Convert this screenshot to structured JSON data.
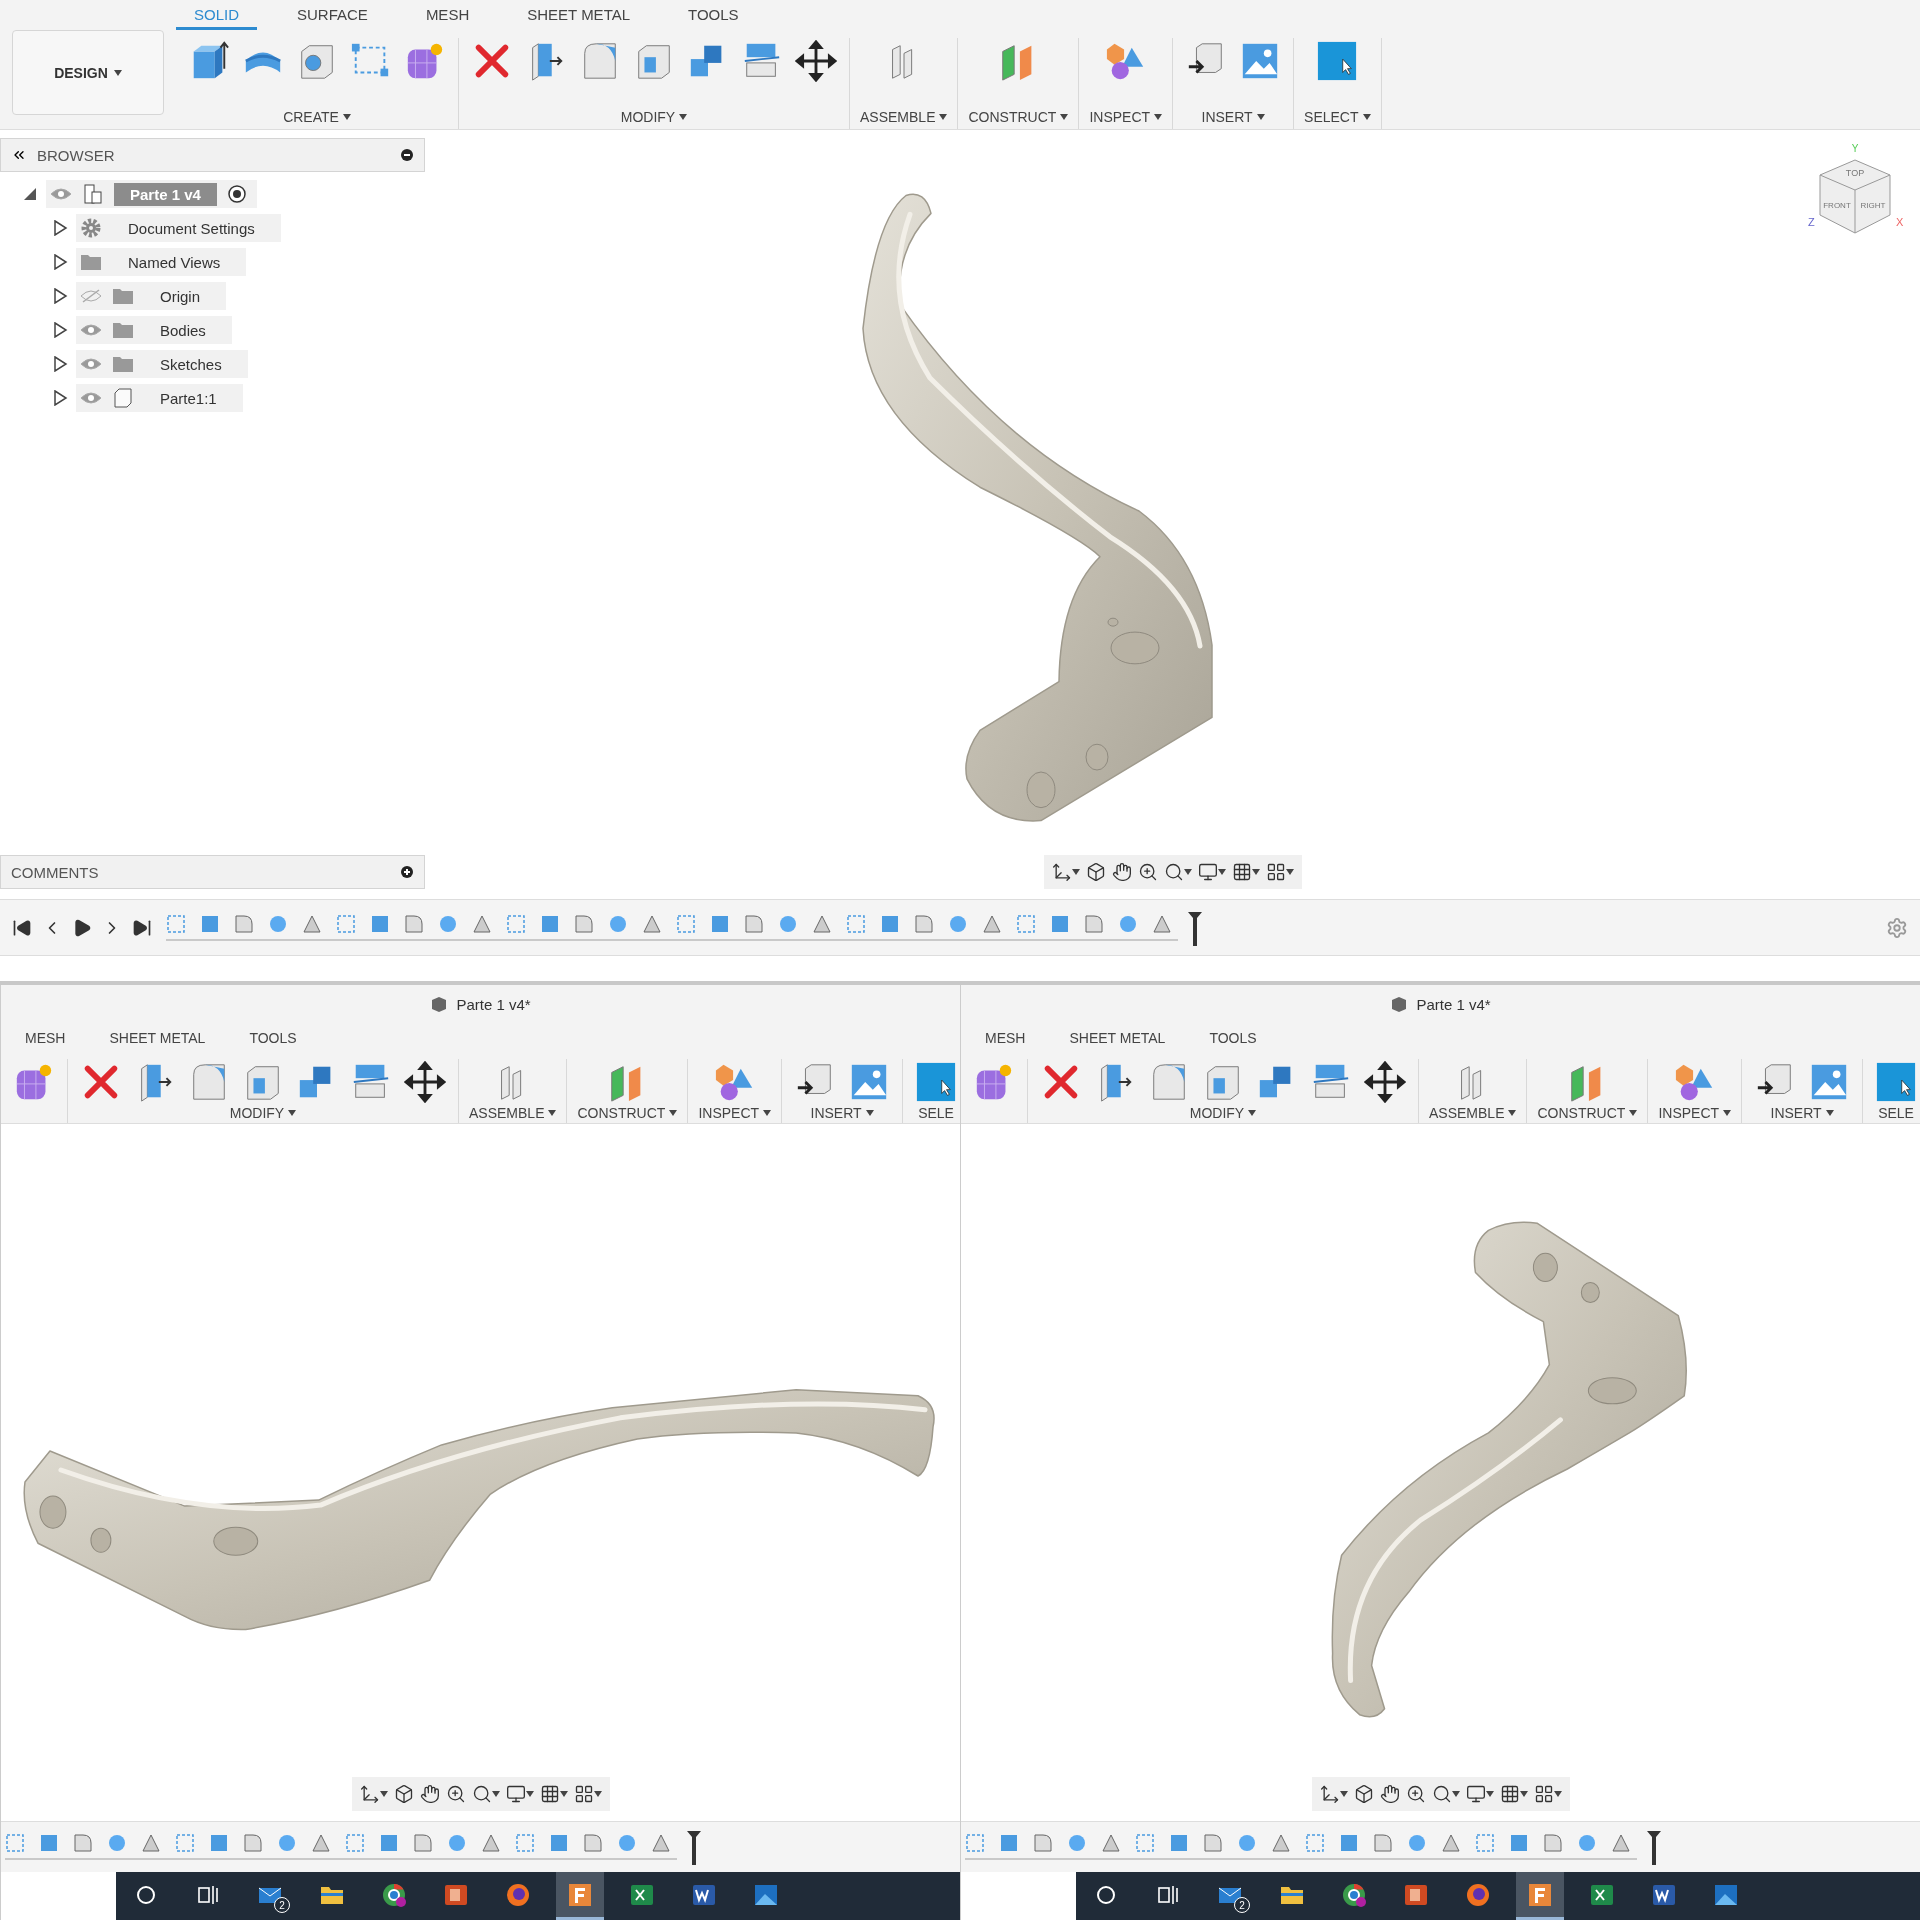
{
  "main": {
    "design_menu": "DESIGN",
    "tabs": [
      {
        "label": "SOLID",
        "selected": true
      },
      {
        "label": "SURFACE",
        "selected": false
      },
      {
        "label": "MESH",
        "selected": false
      },
      {
        "label": "SHEET METAL",
        "selected": false
      },
      {
        "label": "TOOLS",
        "selected": false
      }
    ],
    "groups": [
      "CREATE",
      "MODIFY",
      "ASSEMBLE",
      "CONSTRUCT",
      "INSPECT",
      "INSERT",
      "SELECT"
    ],
    "browser": {
      "title": "BROWSER",
      "tree": [
        {
          "label": "Parte 1 v4",
          "kind": "component",
          "visible": true,
          "expanded": true,
          "selected": true,
          "children": [
            {
              "label": "Document Settings",
              "kind": "settings",
              "expanded": false,
              "selected": false
            },
            {
              "label": "Named Views",
              "kind": "folder",
              "expanded": false,
              "selected": false
            },
            {
              "label": "Origin",
              "kind": "folder",
              "visible": false,
              "expanded": false,
              "selected": false
            },
            {
              "label": "Bodies",
              "kind": "folder",
              "visible": true,
              "expanded": false,
              "selected": false
            },
            {
              "label": "Sketches",
              "kind": "folder",
              "visible": true,
              "expanded": false,
              "selected": false
            },
            {
              "label": "Parte1:1",
              "kind": "body",
              "visible": true,
              "expanded": false,
              "selected": false
            }
          ]
        }
      ]
    },
    "comments": "COMMENTS",
    "view_cube": {
      "faces": [
        "TOP",
        "FRONT",
        "RIGHT"
      ],
      "axes": [
        "Y",
        "Z",
        "X"
      ]
    }
  },
  "panes": [
    {
      "title": "Parte 1 v4*",
      "tabs": [
        "MESH",
        "SHEET METAL",
        "TOOLS"
      ],
      "groups": [
        "MODIFY",
        "ASSEMBLE",
        "CONSTRUCT",
        "INSPECT",
        "INSERT",
        "SELE"
      ],
      "taskbar": [
        {
          "kind": "search",
          "selected": false
        },
        {
          "kind": "task_view",
          "selected": false
        },
        {
          "kind": "mail",
          "selected": false,
          "badge": "2"
        },
        {
          "kind": "folder",
          "selected": false
        },
        {
          "kind": "round_app",
          "selected": false
        },
        {
          "kind": "presentation_app",
          "selected": false
        },
        {
          "kind": "globe_app",
          "selected": false
        },
        {
          "kind": "cad_app",
          "selected": true
        },
        {
          "kind": "spreadsheet_app",
          "selected": false
        },
        {
          "kind": "document_app",
          "selected": false
        },
        {
          "kind": "image_app",
          "selected": false
        }
      ]
    },
    {
      "title": "Parte 1 v4*",
      "tabs": [
        "MESH",
        "SHEET METAL",
        "TOOLS"
      ],
      "groups": [
        "MODIFY",
        "ASSEMBLE",
        "CONSTRUCT",
        "INSPECT",
        "INSERT",
        "SELE"
      ],
      "taskbar": [
        {
          "kind": "search",
          "selected": false
        },
        {
          "kind": "task_view",
          "selected": false
        },
        {
          "kind": "mail",
          "selected": false,
          "badge": "2"
        },
        {
          "kind": "folder",
          "selected": false
        },
        {
          "kind": "round_app",
          "selected": false
        },
        {
          "kind": "presentation_app",
          "selected": false
        },
        {
          "kind": "globe_app",
          "selected": false
        },
        {
          "kind": "cad_app",
          "selected": true
        },
        {
          "kind": "spreadsheet_app",
          "selected": false
        },
        {
          "kind": "document_app",
          "selected": false
        },
        {
          "kind": "image_app",
          "selected": false
        }
      ]
    }
  ]
}
